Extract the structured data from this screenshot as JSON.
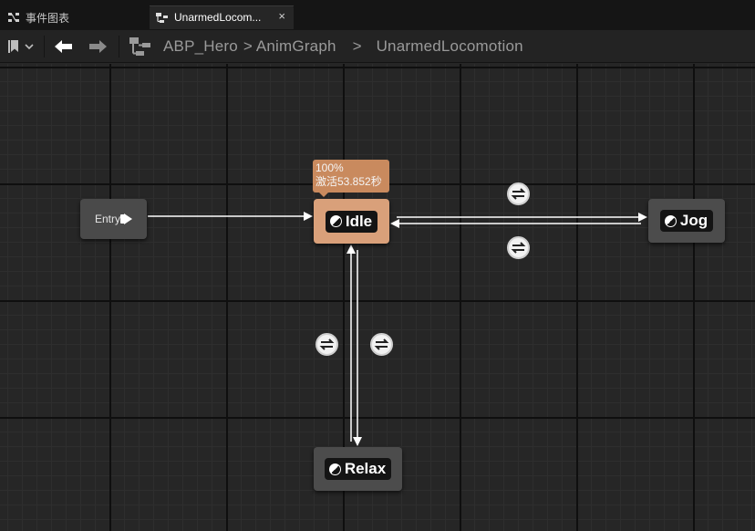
{
  "tabs": [
    {
      "label": "事件图表",
      "icon": "event-graph-icon",
      "active": false
    },
    {
      "label": "UnarmedLocom...",
      "icon": "state-machine-icon",
      "active": true,
      "close": "×"
    }
  ],
  "breadcrumb": {
    "items": [
      "ABP_Hero",
      "AnimGraph",
      "UnarmedLocomotion"
    ],
    "sep": ">"
  },
  "graph": {
    "entry": {
      "label": "Entry"
    },
    "states": {
      "idle": {
        "label": "Idle",
        "active": true
      },
      "jog": {
        "label": "Jog"
      },
      "relax": {
        "label": "Relax"
      }
    },
    "tooltip": {
      "line1": "100%",
      "line2": "激活53.852秒"
    },
    "transitions": [
      {
        "from": "Idle",
        "to": "Jog"
      },
      {
        "from": "Jog",
        "to": "Idle"
      },
      {
        "from": "Idle",
        "to": "Relax"
      },
      {
        "from": "Relax",
        "to": "Idle"
      }
    ]
  },
  "colors": {
    "active_state": "#d9a07a",
    "state_bg": "#4c4c4c",
    "canvas_bg": "#262626",
    "wire": "#ffffff"
  }
}
